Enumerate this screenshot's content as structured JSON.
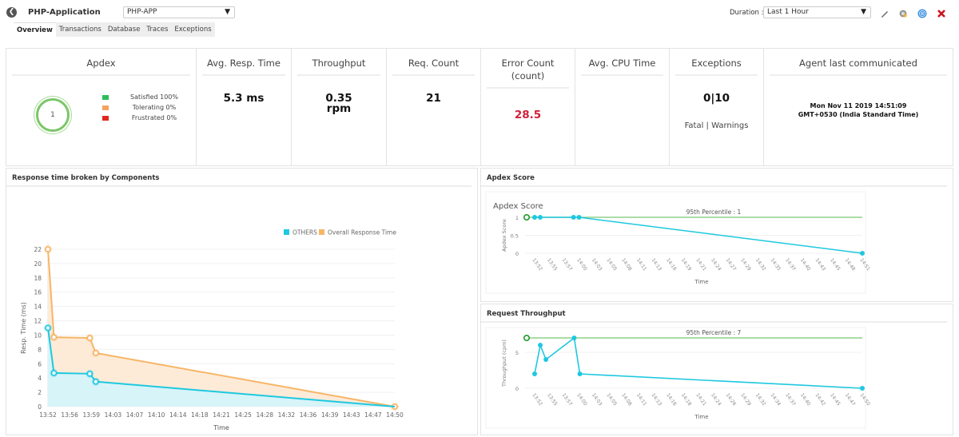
{
  "header": {
    "app_title": "PHP-Application",
    "app_select": "PHP-APP",
    "duration_label": "Duration :",
    "duration_select": "Last 1 Hour",
    "icons": [
      "back-icon",
      "edit-icon",
      "gear-icon",
      "pause-icon",
      "close-icon"
    ]
  },
  "tabs": [
    {
      "label": "Overview",
      "active": true
    },
    {
      "label": "Transactions",
      "active": false
    },
    {
      "label": "Database",
      "active": false
    },
    {
      "label": "Traces",
      "active": false
    },
    {
      "label": "Exceptions",
      "active": false
    }
  ],
  "kpis": {
    "apdex": {
      "title": "Apdex",
      "score": "1",
      "legend": [
        {
          "label": "Satisfied 100%",
          "color": "#2ebd59"
        },
        {
          "label": "Tolerating 0%",
          "color": "#f5a45d"
        },
        {
          "label": "Frustrated 0%",
          "color": "#e0281c"
        }
      ]
    },
    "avg_resp_time": {
      "title": "Avg. Resp. Time",
      "value": "5.3 ms"
    },
    "throughput": {
      "title": "Throughput",
      "value": "0.35",
      "unit": "rpm"
    },
    "req_count": {
      "title": "Req. Count",
      "value": "21"
    },
    "error_count": {
      "title": "Error Count",
      "subtitle": "(count)",
      "value": "28.5"
    },
    "avg_cpu_time": {
      "title": "Avg. CPU Time",
      "value": ""
    },
    "exceptions": {
      "title": "Exceptions",
      "value": "0|10",
      "sub": "Fatal | Warnings"
    },
    "agent": {
      "title": "Agent last communicated",
      "line1": "Mon Nov 11 2019 14:51:09",
      "line2": "GMT+0530 (India Standard Time)"
    }
  },
  "panels": {
    "response": {
      "title": "Response time broken by Components"
    },
    "apdex": {
      "title": "Apdex Score"
    },
    "throughput": {
      "title": "Request Throughput"
    }
  },
  "colors": {
    "others": "#1ec8e0",
    "overall": "#f7b567",
    "percentile": "#8fd08a",
    "accent_red": "#d0203a"
  },
  "chart_data": [
    {
      "type": "area",
      "title": "Response time broken by Components",
      "xlabel": "Time",
      "ylabel": "Resp. Time (ms)",
      "ylim": [
        0,
        22
      ],
      "yticks": [
        0,
        2,
        4,
        6,
        8,
        10,
        12,
        14,
        16,
        18,
        20,
        22
      ],
      "xticks": [
        "13:52",
        "13:56",
        "13:59",
        "14:03",
        "14:07",
        "14:10",
        "14:14",
        "14:18",
        "14:21",
        "14:25",
        "14:28",
        "14:32",
        "14:36",
        "14:39",
        "14:43",
        "14:47",
        "14:50"
      ],
      "x_minutes": [
        0,
        1,
        7,
        8,
        58
      ],
      "x_range_minutes": [
        0,
        58
      ],
      "legend": [
        "OTHERS",
        "Overall Response Time"
      ],
      "legend_position": "top-right",
      "grid": true,
      "series": [
        {
          "name": "Overall Response Time",
          "values": [
            22,
            9.7,
            9.6,
            7.5,
            0
          ]
        },
        {
          "name": "OTHERS",
          "values": [
            11,
            4.7,
            4.6,
            3.5,
            0
          ]
        }
      ]
    },
    {
      "type": "line",
      "title": "Apdex Score",
      "xlabel": "Time",
      "ylabel": "Apdex Score",
      "ylim": [
        0,
        1
      ],
      "yticks": [
        0,
        0.5,
        1
      ],
      "xticks": [
        "13:52",
        "13:55",
        "13:57",
        "14:00",
        "14:03",
        "14:05",
        "14:08",
        "14:11",
        "14:13",
        "14:16",
        "14:19",
        "14:21",
        "14:24",
        "14:27",
        "14:29",
        "14:32",
        "14:35",
        "14:37",
        "14:40",
        "14:43",
        "14:45",
        "14:48",
        "14:51"
      ],
      "x_minutes": [
        0,
        1,
        7,
        8,
        59
      ],
      "x_range_minutes": [
        0,
        59
      ],
      "grid": true,
      "series": [
        {
          "name": "Apdex Score",
          "values": [
            1,
            1,
            1,
            1,
            0
          ]
        }
      ],
      "reference_line": {
        "label": "95th Percentile : 1",
        "value": 1
      }
    },
    {
      "type": "line",
      "title": "Request Throughput",
      "xlabel": "Time",
      "ylabel": "Throughput (cpm)",
      "ylim": [
        0,
        7
      ],
      "yticks": [
        0,
        5
      ],
      "xticks": [
        "13:52",
        "13:55",
        "13:57",
        "14:00",
        "14:03",
        "14:05",
        "14:08",
        "14:11",
        "14:13",
        "14:16",
        "14:18",
        "14:21",
        "14:24",
        "14:26",
        "14:29",
        "14:32",
        "14:34",
        "14:37",
        "14:40",
        "14:42",
        "14:45",
        "14:47",
        "14:50"
      ],
      "x_minutes": [
        0,
        1,
        2,
        7,
        8,
        58
      ],
      "x_range_minutes": [
        0,
        58
      ],
      "grid": true,
      "series": [
        {
          "name": "Throughput",
          "values": [
            2,
            6,
            4,
            7,
            2,
            0
          ]
        }
      ],
      "reference_line": {
        "label": "95th Percentile : 7",
        "value": 7
      }
    }
  ]
}
